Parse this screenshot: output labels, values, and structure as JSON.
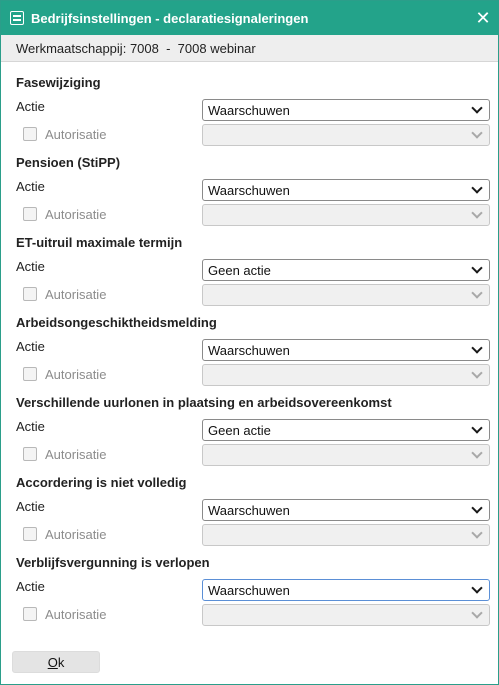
{
  "window": {
    "title": "Bedrijfsinstellingen - declaratiesignaleringen",
    "close_icon": "close-icon",
    "title_icon": "settings-panel-icon"
  },
  "subheader": {
    "label": "Werkmaatschappij:",
    "code": "7008",
    "separator": "-",
    "name": "7008 webinar"
  },
  "labels": {
    "actie": "Actie",
    "autorisatie": "Autorisatie"
  },
  "sections": [
    {
      "title": "Fasewijziging",
      "actie_value": "Waarschuwen",
      "autorisatie_checked": false
    },
    {
      "title": "Pensioen (StiPP)",
      "actie_value": "Waarschuwen",
      "autorisatie_checked": false
    },
    {
      "title": "ET-uitruil maximale termijn",
      "actie_value": "Geen actie",
      "autorisatie_checked": false
    },
    {
      "title": "Arbeidsongeschiktheidsmelding",
      "actie_value": "Waarschuwen",
      "autorisatie_checked": false
    },
    {
      "title": "Verschillende uurlonen in plaatsing en arbeidsovereenkomst",
      "actie_value": "Geen actie",
      "autorisatie_checked": false
    },
    {
      "title": "Accordering is niet volledig",
      "actie_value": "Waarschuwen",
      "autorisatie_checked": false
    },
    {
      "title": "Verblijfsvergunning is verlopen",
      "actie_value": "Waarschuwen",
      "autorisatie_checked": false
    }
  ],
  "footer": {
    "ok_label_first": "O",
    "ok_label_rest": "k"
  },
  "colors": {
    "titlebar": "#23a38a",
    "focus_border": "#5b8fd6"
  }
}
